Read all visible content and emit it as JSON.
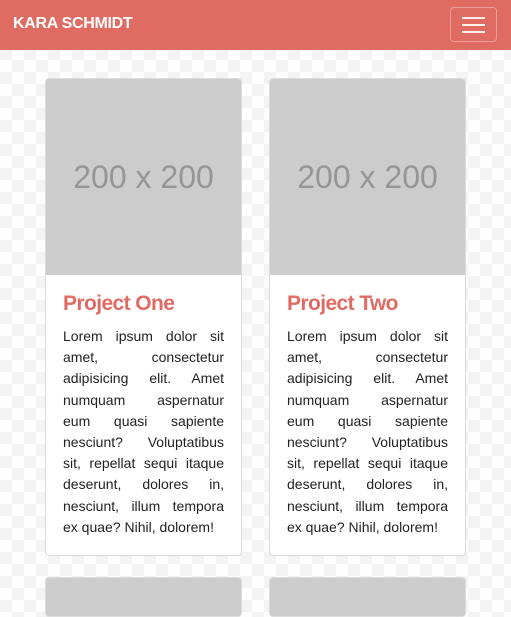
{
  "navbar": {
    "brand": "KARA SCHMIDT",
    "toggle_icon": "hamburger-menu-icon",
    "color": "#df6b62"
  },
  "cards": [
    {
      "image_text": "200 x 200",
      "title": "Project One",
      "text": "Lorem ipsum dolor sit amet, consectetur adipisicing elit. Amet numquam aspernatur eum quasi sapiente nesciunt? Voluptatibus sit, repellat sequi itaque deserunt, dolores in, nesciunt, illum tempora ex quae? Nihil, dolorem!"
    },
    {
      "image_text": "200 x 200",
      "title": "Project Two",
      "text": "Lorem ipsum dolor sit amet, consectetur adipisicing elit. Amet numquam aspernatur eum quasi sapiente nesciunt? Voluptatibus sit, repellat sequi itaque deserunt, dolores in, nesciunt, illum tempora ex quae? Nihil, dolorem!"
    }
  ]
}
